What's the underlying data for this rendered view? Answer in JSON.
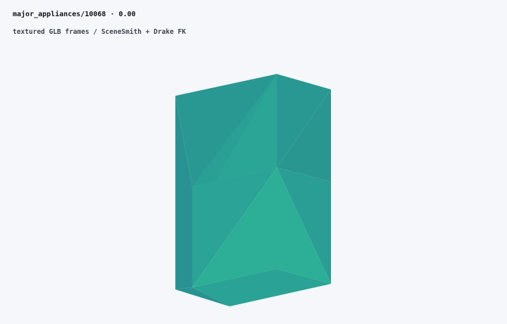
{
  "header": {
    "asset_id": "major_appliances/10068",
    "separator": "·",
    "value": "0.00",
    "subtitle": "textured GLB frames / SceneSmith + Drake FK"
  },
  "viewport": {
    "object": "appliance-box-mesh",
    "colors": {
      "background": "#f5f7fb",
      "teal_dark": "#2a9590",
      "teal_mid": "#2ba096",
      "teal_light": "#2cb096"
    }
  }
}
